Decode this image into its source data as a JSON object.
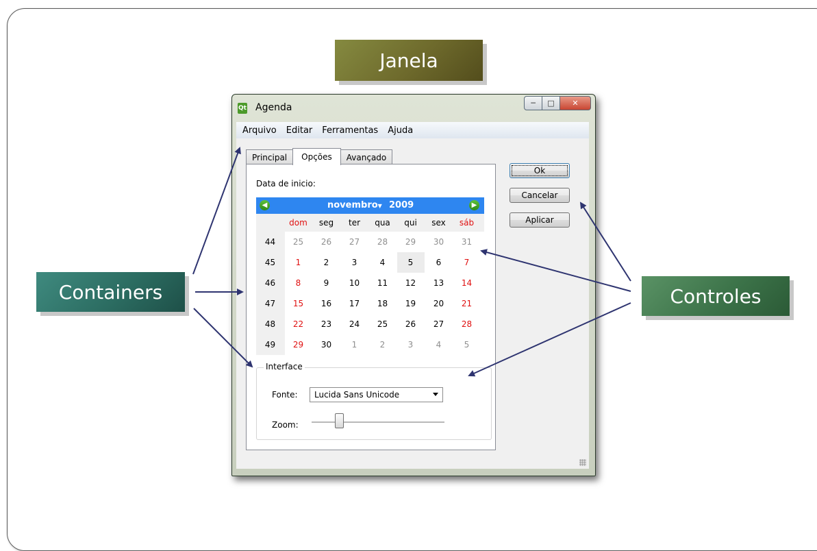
{
  "callouts": {
    "janela": "Janela",
    "containers": "Containers",
    "controles": "Controles"
  },
  "window": {
    "title": "Agenda",
    "icon": "qt-app-icon",
    "minimize_icon": "minimize-icon",
    "maximize_icon": "maximize-icon",
    "close_icon": "close-icon"
  },
  "menu": {
    "items": [
      "Arquivo",
      "Editar",
      "Ferramentas",
      "Ajuda"
    ]
  },
  "tabs": {
    "items": [
      "Principal",
      "Opções",
      "Avançado"
    ],
    "active": "Opções"
  },
  "date_field": {
    "label": "Data de inicio:"
  },
  "calendar": {
    "month": "novembro",
    "year": "2009",
    "weekdays": [
      "dom",
      "seg",
      "ter",
      "qua",
      "qui",
      "sex",
      "sáb"
    ],
    "weeks": [
      {
        "num": "44",
        "days": [
          "25",
          "26",
          "27",
          "28",
          "29",
          "30",
          "31"
        ]
      },
      {
        "num": "45",
        "days": [
          "1",
          "2",
          "3",
          "4",
          "5",
          "6",
          "7"
        ]
      },
      {
        "num": "46",
        "days": [
          "8",
          "9",
          "10",
          "11",
          "12",
          "13",
          "14"
        ]
      },
      {
        "num": "47",
        "days": [
          "15",
          "16",
          "17",
          "18",
          "19",
          "20",
          "21"
        ]
      },
      {
        "num": "48",
        "days": [
          "22",
          "23",
          "24",
          "25",
          "26",
          "27",
          "28"
        ]
      },
      {
        "num": "49",
        "days": [
          "29",
          "30",
          "1",
          "2",
          "3",
          "4",
          "5"
        ]
      }
    ],
    "selected_day": "5",
    "prev_icon": "arrow-left-icon",
    "next_icon": "arrow-right-icon",
    "weekend_color": "#e01010",
    "header_color": "#2e86f0"
  },
  "interface_group": {
    "title": "Interface",
    "font_label": "Fonte:",
    "font_value": "Lucida Sans Unicode",
    "zoom_label": "Zoom:",
    "zoom_level": 0.2
  },
  "buttons": {
    "ok": "Ok",
    "cancel": "Cancelar",
    "apply": "Aplicar"
  },
  "colors": {
    "arrow": "#2e3470"
  }
}
